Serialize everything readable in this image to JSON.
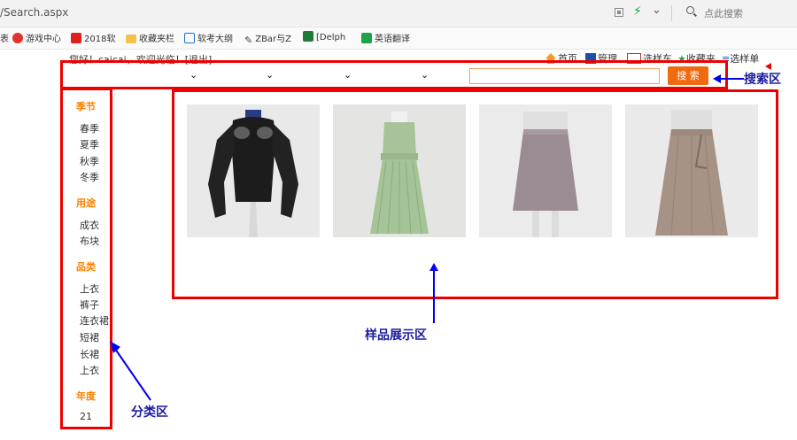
{
  "browser": {
    "url": "/Search.aspx",
    "search_placeholder": "点此搜索",
    "icons": [
      "qr-icon",
      "lightning-icon",
      "chevron-down-icon",
      "search-icon"
    ],
    "bookmarks": [
      {
        "label": "游戏中心",
        "icon": "game-icon",
        "color": "#e0322e"
      },
      {
        "label": "2018软",
        "icon": "c-logo-icon",
        "color": "#e02020"
      },
      {
        "label": "收藏夹栏",
        "icon": "folder-icon",
        "color": "#f2c14e"
      },
      {
        "label": "软考大纲",
        "icon": "ie-icon",
        "color": "#1b6fd0"
      },
      {
        "label": "ZBar与Z",
        "icon": "wrench-icon",
        "color": "#444444"
      },
      {
        "label": "[Delph",
        "icon": "house-icon",
        "color": "#207a3a"
      },
      {
        "label": "英语翻译",
        "icon": "c-logo-icon",
        "color": "#1aa34a"
      }
    ],
    "left_fragment": "表"
  },
  "site": {
    "welcome": "您好！caicai，欢迎光临！[退出]",
    "top_links": [
      {
        "label": "首页",
        "icon": "home-icon"
      },
      {
        "label": "管理",
        "icon": "manage-icon"
      },
      {
        "label": "选样车",
        "icon": "cart-icon"
      },
      {
        "label": "收藏夹",
        "icon": "star-icon"
      },
      {
        "label": "选样单",
        "icon": "list-icon"
      }
    ],
    "search_button": "搜 索"
  },
  "sidebar": {
    "groups": [
      {
        "title": "季节",
        "items": [
          "春季",
          "夏季",
          "秋季",
          "冬季"
        ]
      },
      {
        "title": "用途",
        "items": [
          "成衣",
          "布块"
        ]
      },
      {
        "title": "品类",
        "items": [
          "上衣",
          "裤子",
          "连衣裙",
          "短裙",
          "长裙",
          "上衣"
        ]
      },
      {
        "title": "年度",
        "items": [
          "21"
        ]
      }
    ]
  },
  "products": [
    {
      "name": "black-blouse",
      "color": "#1a1a1a"
    },
    {
      "name": "green-dress",
      "color": "#a9c79c"
    },
    {
      "name": "gray-skirt",
      "color": "#9a8a8f"
    },
    {
      "name": "plaid-skirt",
      "color": "#a59286"
    }
  ],
  "annotations": {
    "search_area": "搜索区",
    "display_area": "样品展示区",
    "category_area": "分类区"
  },
  "colors": {
    "annotation_red": "#ee0000",
    "accent_orange": "#f06a10",
    "title_orange": "#ff8000",
    "arrow_blue": "#0000ee"
  }
}
